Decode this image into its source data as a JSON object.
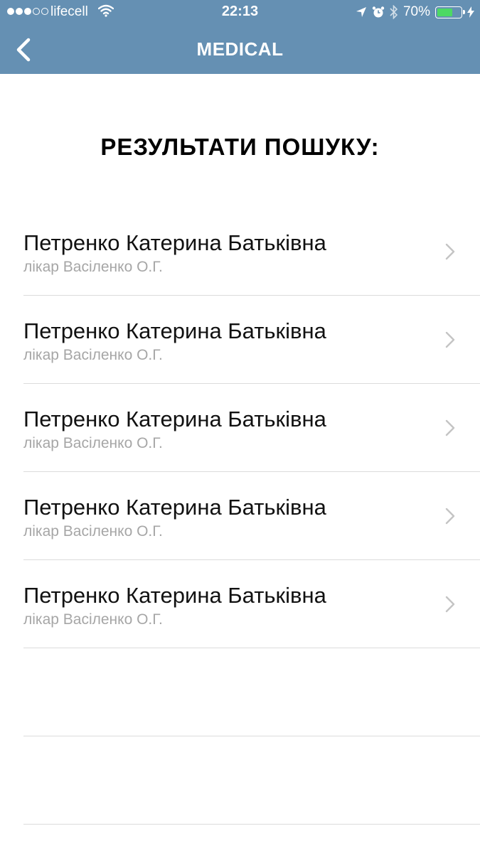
{
  "status_bar": {
    "carrier": "lifecell",
    "time": "22:13",
    "battery": "70%",
    "battery_level": 0.7,
    "icons": [
      "signal-dots",
      "wifi-icon",
      "location-arrow-icon",
      "alarm-icon",
      "bluetooth-icon",
      "battery-icon",
      "charging-bolt-icon"
    ]
  },
  "nav": {
    "title": "MEDICAL",
    "back_icon": "chevron-left-icon"
  },
  "page": {
    "title": "РЕЗУЛЬТАТИ ПОШУКУ:"
  },
  "results": [
    {
      "name": "Петренко Катерина Батьківна",
      "subtitle": "лікар Васіленко О.Г."
    },
    {
      "name": "Петренко Катерина Батьківна",
      "subtitle": "лікар Васіленко О.Г."
    },
    {
      "name": "Петренко Катерина Батьківна",
      "subtitle": "лікар Васіленко О.Г."
    },
    {
      "name": "Петренко Катерина Батьківна",
      "subtitle": "лікар Васіленко О.Г."
    },
    {
      "name": "Петренко Катерина Батьківна",
      "subtitle": "лікар Васіленко О.Г."
    }
  ],
  "colors": {
    "header": "#6590b3",
    "battery_fill": "#4cd964",
    "separator": "#dcdcdc",
    "subtitle": "#a6a6a6"
  }
}
